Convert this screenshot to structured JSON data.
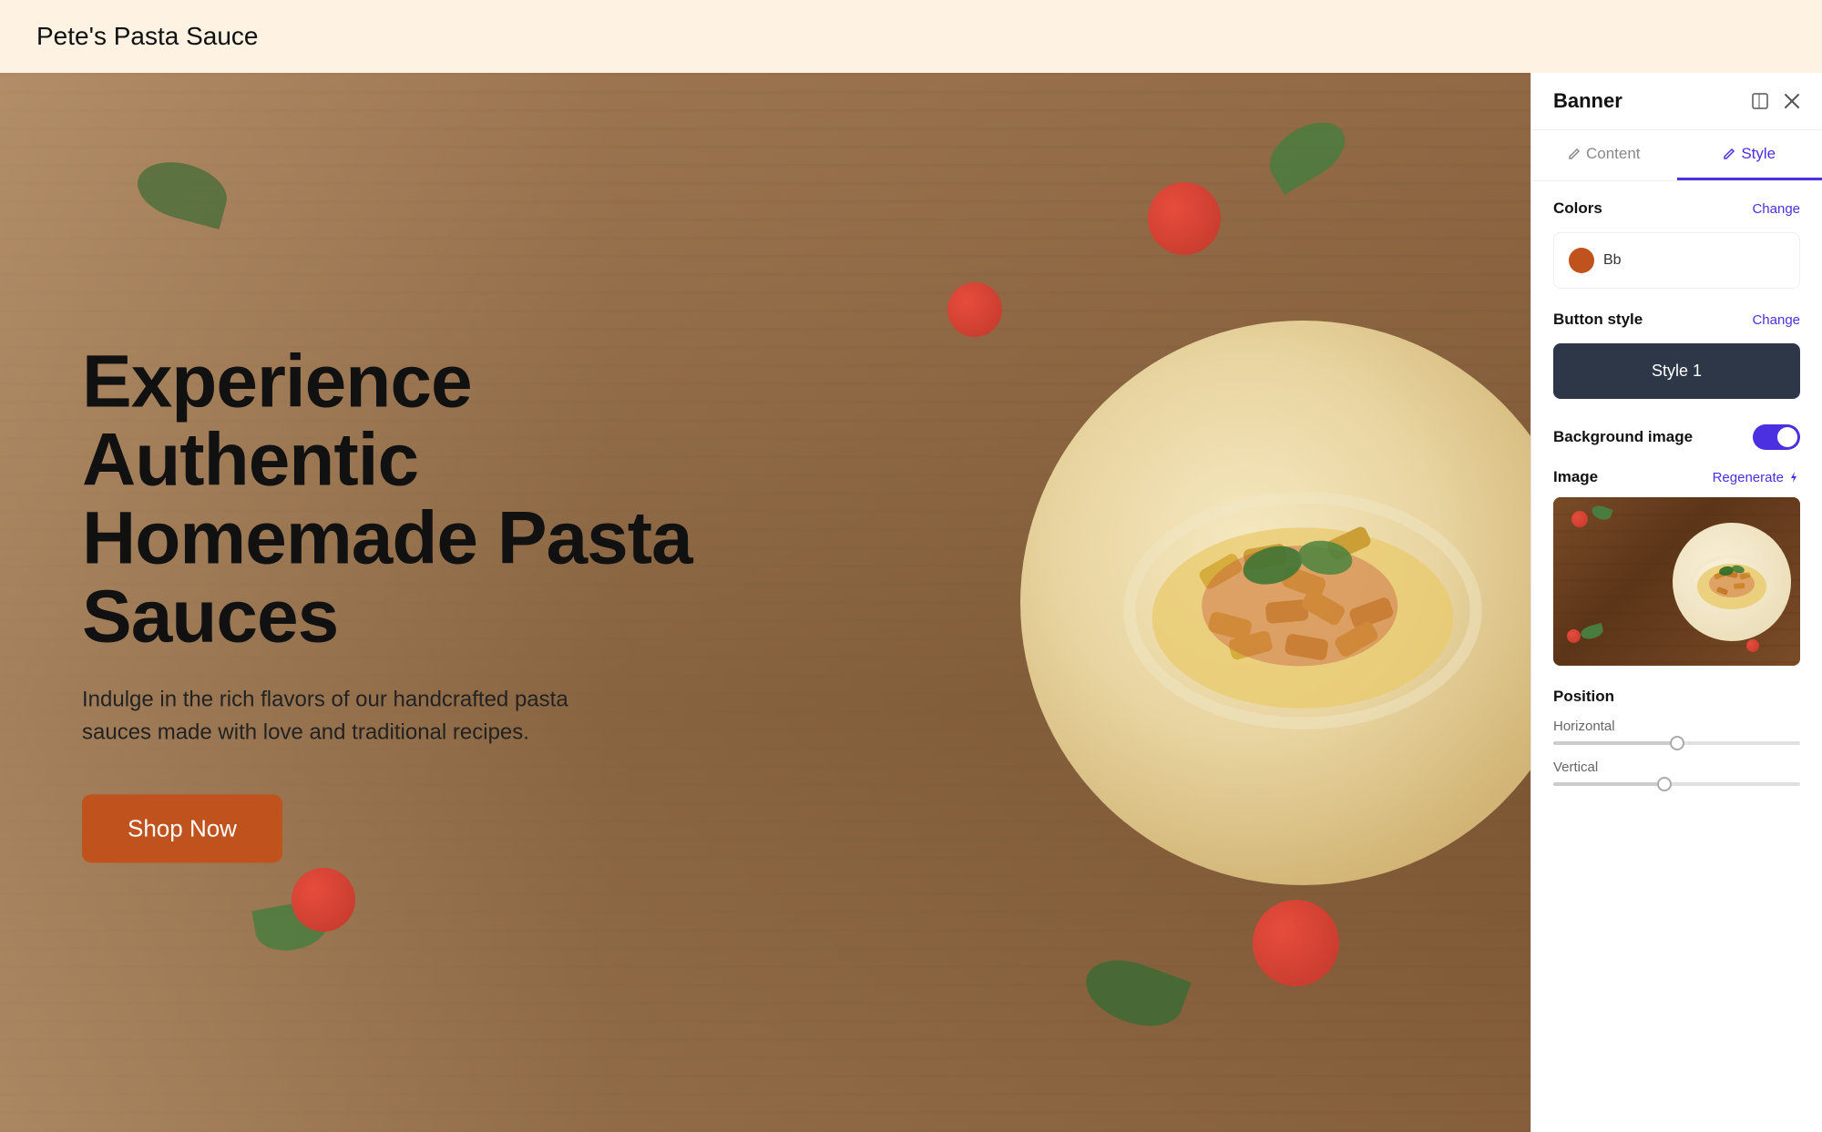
{
  "header": {
    "title": "Pete's Pasta Sauce"
  },
  "banner": {
    "heading": "Experience Authentic Homemade Pasta Sauces",
    "subtext": "Indulge in the rich flavors of our handcrafted pasta sauces made with love and traditional recipes.",
    "cta_label": "Shop Now"
  },
  "panel": {
    "title": "Banner",
    "tabs": [
      {
        "id": "content",
        "label": "Content",
        "active": false
      },
      {
        "id": "style",
        "label": "Style",
        "active": true
      }
    ],
    "colors_section": {
      "label": "Colors",
      "change_label": "Change",
      "color_swatch": {
        "color": "#c0521e",
        "name": "Bb"
      }
    },
    "button_style_section": {
      "label": "Button style",
      "change_label": "Change",
      "preview_label": "Style 1"
    },
    "background_image_section": {
      "label": "Background image",
      "enabled": true
    },
    "image_section": {
      "label": "Image",
      "regenerate_label": "Regenerate"
    },
    "position_section": {
      "label": "Position",
      "horizontal_label": "Horizontal",
      "vertical_label": "Vertical"
    },
    "icons": {
      "collapse": "⊡",
      "close": "✕",
      "content_icon": "✏",
      "style_icon": "✏"
    }
  }
}
